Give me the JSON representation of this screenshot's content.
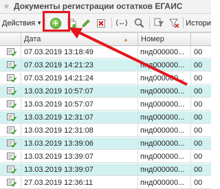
{
  "window": {
    "title": "Документы регистрации остатков ЕГАИС"
  },
  "toolbar": {
    "actions_label": "Действия",
    "history_label": "Истори",
    "icons": [
      "add-icon",
      "copy-icon",
      "edit-icon",
      "delete-icon",
      "switch-icon",
      "search-icon",
      "filter-icon",
      "clear-filter-icon"
    ]
  },
  "colors": {
    "highlight": "#e4151b",
    "row_alt": "#d2f2f2",
    "add_green": "#47a521"
  },
  "table": {
    "columns": [
      "Дата",
      "Номер",
      ""
    ],
    "rows": [
      {
        "date": "07.03.2019 13:18:49",
        "number": "пнд000000...",
        "extra": "00"
      },
      {
        "date": "07.03.2019 14:21:23",
        "number": "пнд000000...",
        "extra": "00"
      },
      {
        "date": "07.03.2019 14:21:24",
        "number": "пнд000000...",
        "extra": "00"
      },
      {
        "date": "13.03.2019 10:57:07",
        "number": "пнд000000...",
        "extra": "00"
      },
      {
        "date": "13.03.2019 10:57:07",
        "number": "пнд000000...",
        "extra": "00"
      },
      {
        "date": "13.03.2019 12:31:07",
        "number": "пнд000000...",
        "extra": "00"
      },
      {
        "date": "13.03.2019 12:31:08",
        "number": "пнд000000...",
        "extra": "00"
      },
      {
        "date": "13.03.2019 13:39:06",
        "number": "пнд000000...",
        "extra": "00"
      },
      {
        "date": "13.03.2019 13:39:07",
        "number": "пнд000000...",
        "extra": "00"
      },
      {
        "date": "13.03.2019 13:39:07",
        "number": "пнд000000...",
        "extra": "00"
      },
      {
        "date": "27.03.2019 12:36:11",
        "number": "пнд000000...",
        "extra": "00"
      }
    ]
  }
}
